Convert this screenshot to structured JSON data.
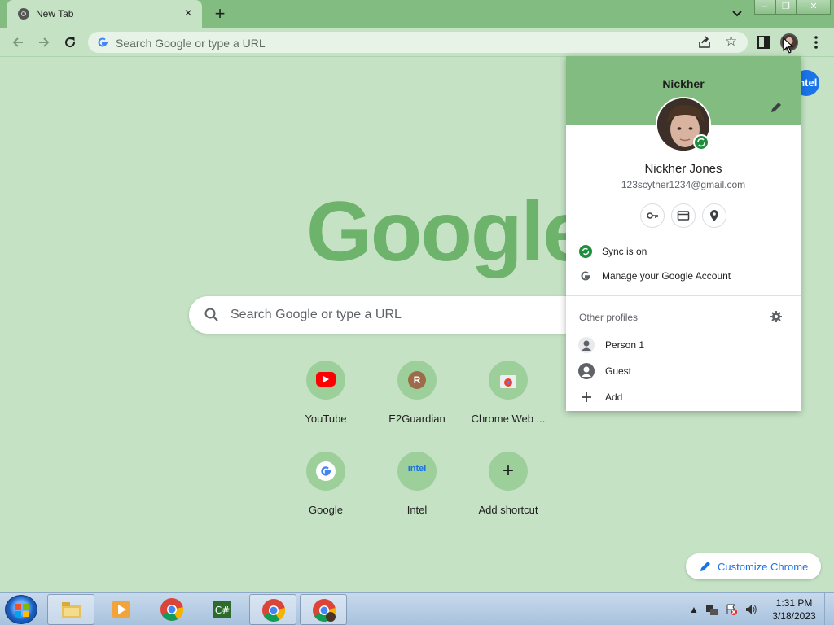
{
  "browser": {
    "tab_title": "New Tab",
    "tab_close": "×",
    "new_tab": "+",
    "omnibox_placeholder": "Search Google or type a URL"
  },
  "page": {
    "logo": "Google",
    "search_placeholder": "Search Google or type a URL",
    "shortcuts": [
      {
        "label": "YouTube",
        "icon": "youtube-icon"
      },
      {
        "label": "E2Guardian",
        "icon": "letter-r-icon",
        "letter": "R"
      },
      {
        "label": "Chrome Web ...",
        "icon": "chrome-web-store-icon"
      },
      {
        "label": "Google",
        "icon": "google-icon"
      },
      {
        "label": "Intel",
        "icon": "intel-icon",
        "letter": "intel"
      },
      {
        "label": "Add shortcut",
        "icon": "plus-icon",
        "letter": "+"
      }
    ],
    "customize": "Customize Chrome",
    "intel_corner": "intel"
  },
  "profile_popup": {
    "header_name": "Nickher",
    "full_name": "Nickher Jones",
    "email": "123scyther1234@gmail.com",
    "sync": "Sync is on",
    "manage": "Manage your Google Account",
    "other_profiles": "Other profiles",
    "profiles": [
      {
        "label": "Person 1",
        "icon": "person-icon"
      },
      {
        "label": "Guest",
        "icon": "guest-icon"
      },
      {
        "label": "Add",
        "icon": "add-icon"
      }
    ]
  },
  "taskbar": {
    "time": "1:31 PM",
    "date": "3/18/2023"
  },
  "colors": {
    "theme_light": "#c5e2c4",
    "theme_dark": "#82bc80",
    "logo": "#6db36b",
    "accent": "#1a73e8",
    "sync_green": "#1e8e3e"
  }
}
